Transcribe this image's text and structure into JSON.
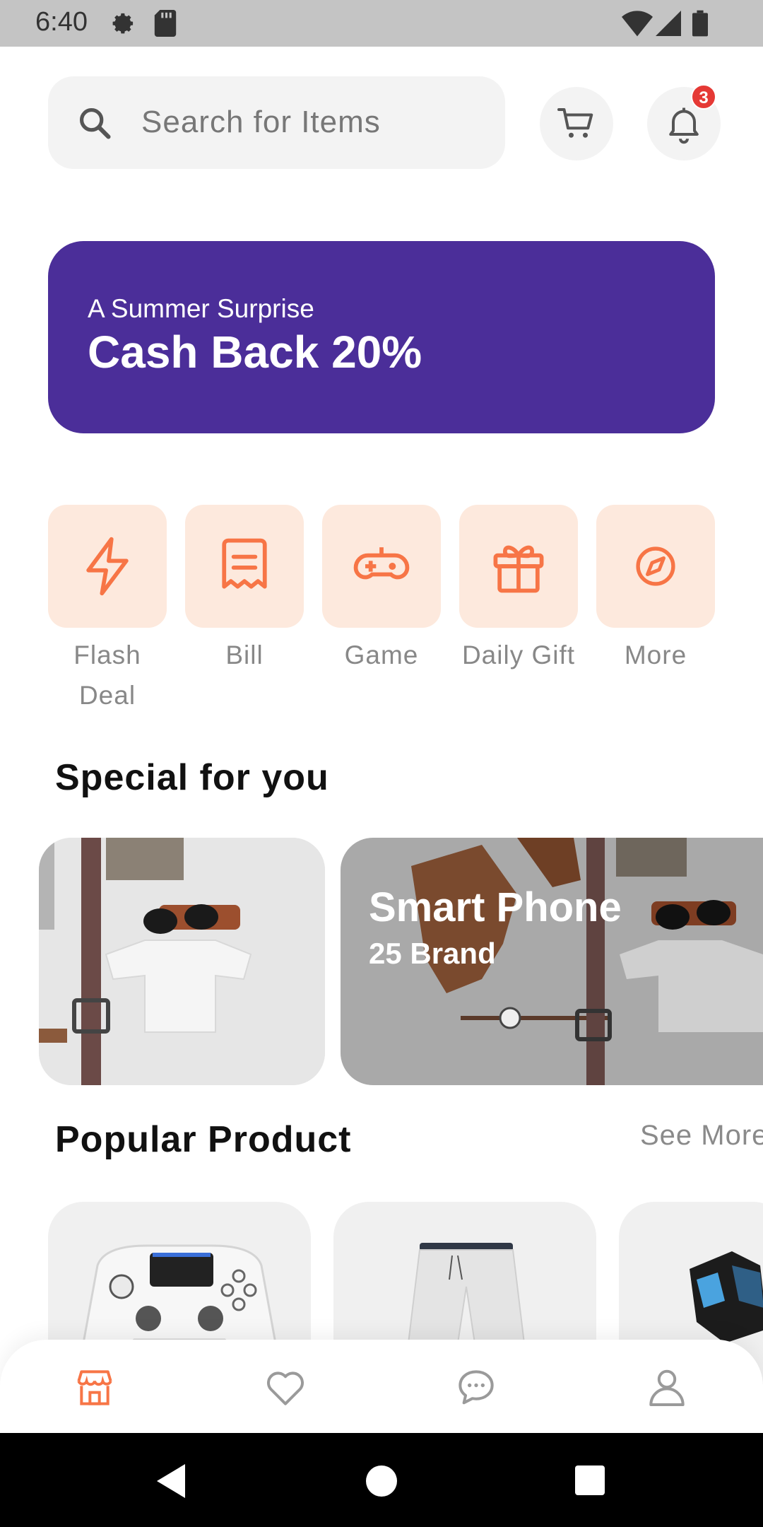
{
  "status_bar": {
    "time": "6:40",
    "icons": [
      "settings-icon",
      "sd-card-icon",
      "wifi-icon",
      "signal-icon",
      "battery-icon"
    ]
  },
  "header": {
    "search": {
      "placeholder": "Search for Items",
      "icon": "search-icon"
    },
    "cart": {
      "icon": "cart-icon"
    },
    "notifications": {
      "icon": "bell-icon",
      "badge_count": "3"
    }
  },
  "promo_banner": {
    "subtitle": "A Summer Surprise",
    "title": "Cash Back 20%",
    "background_color": "#4b2e99"
  },
  "categories": [
    {
      "label": "Flash Deal",
      "icon": "flash-icon"
    },
    {
      "label": "Bill",
      "icon": "bill-icon"
    },
    {
      "label": "Game",
      "icon": "gamepad-icon"
    },
    {
      "label": "Daily Gift",
      "icon": "gift-icon"
    },
    {
      "label": "More",
      "icon": "compass-icon"
    }
  ],
  "special_section": {
    "title": "Special for you",
    "cards": [
      {
        "title": "",
        "subtitle": ""
      },
      {
        "title": "Smart Phone",
        "subtitle": "25 Brand"
      }
    ]
  },
  "popular_section": {
    "title": "Popular Product",
    "see_more": "See More",
    "products": [
      {
        "icon": "game-controller-image"
      },
      {
        "icon": "shorts-image"
      },
      {
        "icon": "gloves-image"
      }
    ]
  },
  "bottom_nav": {
    "items": [
      {
        "icon": "shop-icon",
        "active": true
      },
      {
        "icon": "heart-icon",
        "active": false
      },
      {
        "icon": "chat-icon",
        "active": false
      },
      {
        "icon": "user-icon",
        "active": false
      }
    ]
  },
  "colors": {
    "accent": "#f77546",
    "category_bg": "#fde9dd",
    "badge": "#e53935"
  }
}
